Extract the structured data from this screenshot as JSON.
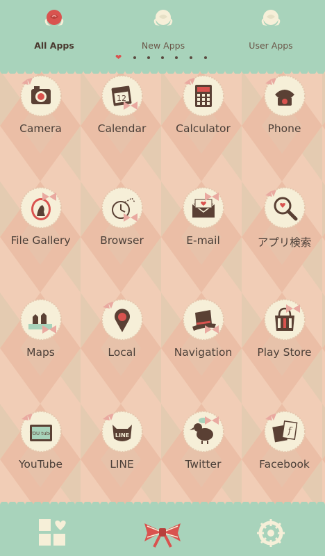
{
  "tabs": [
    {
      "label": "All Apps",
      "active": true
    },
    {
      "label": "New Apps",
      "active": false
    },
    {
      "label": "User Apps",
      "active": false
    }
  ],
  "page_indicator": {
    "current": 1,
    "total": 7
  },
  "apps": [
    {
      "label": "Camera",
      "icon": "camera-icon"
    },
    {
      "label": "Calendar",
      "icon": "calendar-icon",
      "icon_text": "12"
    },
    {
      "label": "Calculator",
      "icon": "calculator-icon"
    },
    {
      "label": "Phone",
      "icon": "phone-icon"
    },
    {
      "label": "File Gallery",
      "icon": "gallery-icon"
    },
    {
      "label": "Browser",
      "icon": "pocket-watch-icon"
    },
    {
      "label": "E-mail",
      "icon": "envelope-icon"
    },
    {
      "label": "アプリ検索",
      "icon": "magnifier-icon"
    },
    {
      "label": "Maps",
      "icon": "chess-icon"
    },
    {
      "label": "Local",
      "icon": "map-pin-icon"
    },
    {
      "label": "Navigation",
      "icon": "hat-icon"
    },
    {
      "label": "Play Store",
      "icon": "bag-icon"
    },
    {
      "label": "YouTube",
      "icon": "youtube-icon",
      "icon_text": "YOU tube"
    },
    {
      "label": "LINE",
      "icon": "line-icon",
      "icon_text": "LINE"
    },
    {
      "label": "Twitter",
      "icon": "dodo-bird-icon"
    },
    {
      "label": "Facebook",
      "icon": "facebook-icon",
      "icon_text": "f"
    }
  ],
  "dock": [
    {
      "icon": "app-grid-heart-icon"
    },
    {
      "icon": "bow-icon"
    },
    {
      "icon": "gear-icon"
    }
  ],
  "colors": {
    "mint": "#a8d3bb",
    "peach": "#f1cdb6",
    "diamond_dark": "#e7b29a",
    "diamond_green": "#cfd2b6",
    "text": "#4b3f38",
    "rose_red": "#d9534f",
    "cream": "#f6efd8",
    "brown": "#5a4034"
  }
}
